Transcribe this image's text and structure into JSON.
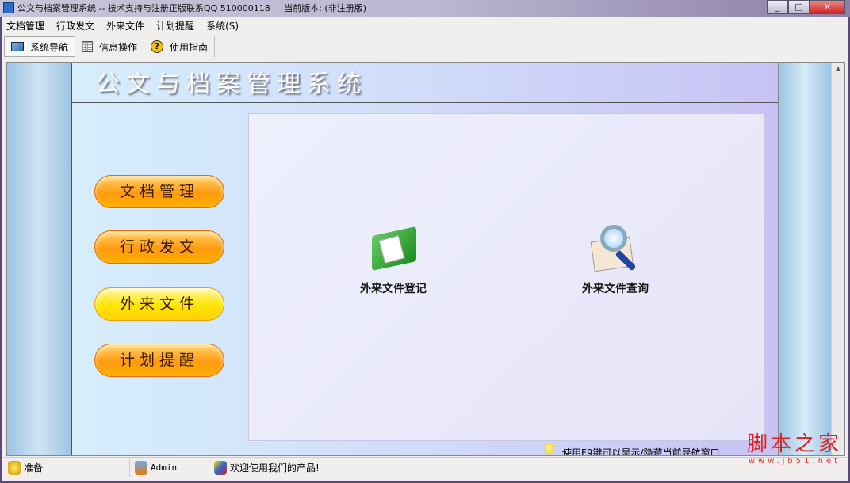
{
  "window": {
    "title": "公文与档案管理系统 -- 技术支持与注册正版联系QQ 510000118     当前版本: (非注册版)",
    "minimize": "0",
    "maximize": "1",
    "close": "r"
  },
  "menu": [
    "文档管理",
    "行政发文",
    "外来文件",
    "计划提醒",
    "系统(S)"
  ],
  "toolbar": [
    {
      "label": "系统导航",
      "icon": "navigation-icon"
    },
    {
      "label": "信息操作",
      "icon": "grid-icon"
    },
    {
      "label": "使用指南",
      "icon": "help-icon"
    }
  ],
  "main": {
    "title": "公文与档案管理系统",
    "nav_buttons": [
      "文档管理",
      "行政发文",
      "外来文件",
      "计划提醒"
    ],
    "selected": "外来文件",
    "tiles": [
      {
        "label": "外来文件登记",
        "icon": "green-book-icon"
      },
      {
        "label": "外来文件查询",
        "icon": "magnifier-icon"
      }
    ],
    "hint": "使用F9键可以显示/隐藏当前导航窗口"
  },
  "status": {
    "state": "准备",
    "user": "Admin",
    "message": "欢迎使用我们的产品!"
  },
  "watermark": {
    "text": "脚本之家",
    "url": "www.jb51.net"
  }
}
